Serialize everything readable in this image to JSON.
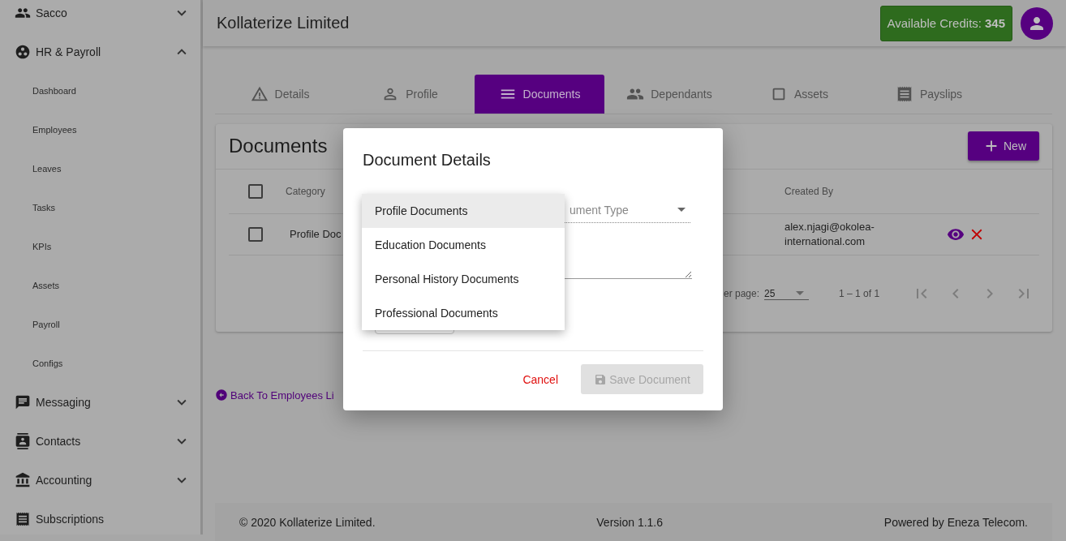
{
  "sidebar": {
    "items": [
      {
        "label": "Sacco",
        "expanded": false
      },
      {
        "label": "HR & Payroll",
        "expanded": true,
        "children": [
          {
            "label": "Dashboard"
          },
          {
            "label": "Employees"
          },
          {
            "label": "Leaves"
          },
          {
            "label": "Tasks"
          },
          {
            "label": "KPIs"
          },
          {
            "label": "Assets"
          },
          {
            "label": "Payroll"
          },
          {
            "label": "Configs"
          }
        ]
      },
      {
        "label": "Messaging",
        "expanded": false
      },
      {
        "label": "Contacts",
        "expanded": false
      },
      {
        "label": "Accounting",
        "expanded": false
      },
      {
        "label": "Subscriptions"
      }
    ]
  },
  "header": {
    "title": "Kollaterize Limited",
    "credits_label": "Available Credits:",
    "credits_value": "345"
  },
  "tabs": [
    {
      "label": "Details",
      "selected": false
    },
    {
      "label": "Profile",
      "selected": false
    },
    {
      "label": "Documents",
      "selected": true
    },
    {
      "label": "Dependants",
      "selected": false
    },
    {
      "label": "Assets",
      "selected": false
    },
    {
      "label": "Payslips",
      "selected": false
    }
  ],
  "documents": {
    "title": "Documents",
    "new_button": "New",
    "columns": [
      "Category",
      "Created By"
    ],
    "select_all_checked": false,
    "rows": [
      {
        "checked": false,
        "category": "Profile Doc",
        "created_by": "alex.njagi@okolea-international.com"
      }
    ],
    "pagination": {
      "rows_label": "er page:",
      "rows_per_page": "25",
      "range": "1 – 1 of 1"
    }
  },
  "back_link": "Back To Employees Li",
  "footer": {
    "copyright": "© 2020 Kollaterize Limited.",
    "version": "Version 1.1.6",
    "powered": "Powered by Eneza Telecom."
  },
  "dialog": {
    "title": "Document Details",
    "type_placeholder": "ument Type",
    "cancel": "Cancel",
    "save": "Save Document",
    "save_disabled": true,
    "menu": [
      {
        "label": "Profile Documents",
        "selected": true
      },
      {
        "label": "Education Documents",
        "selected": false
      },
      {
        "label": "Personal History Documents",
        "selected": false
      },
      {
        "label": "Professional Documents",
        "selected": false
      }
    ]
  }
}
